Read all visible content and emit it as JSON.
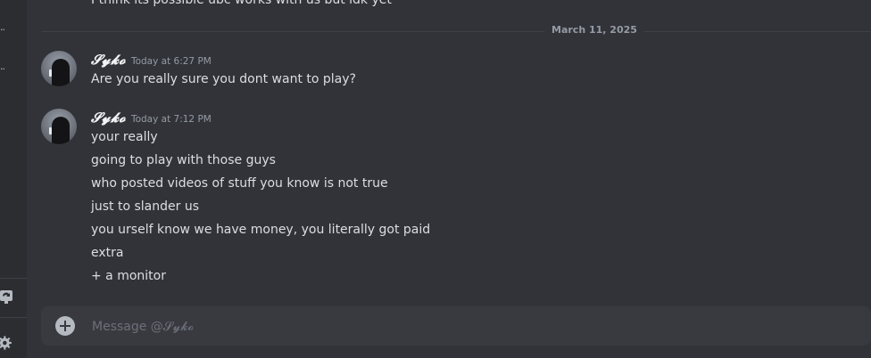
{
  "sidebar": {
    "dots_1": "..",
    "dots_2": "..",
    "icons": [
      "refresh-icon",
      "gear-icon"
    ]
  },
  "chat": {
    "previous_message_text": "I think its possible ubc works with us but idk yet",
    "date_divider": "March 11, 2025",
    "messages": [
      {
        "username": "𝓢𝔂𝓴𝓸",
        "timestamp": "Today at 6:27 PM",
        "lines": [
          "Are you really sure you dont want to play?"
        ]
      },
      {
        "username": "𝓢𝔂𝓴𝓸",
        "timestamp": "Today at 7:12 PM",
        "lines": [
          "your really",
          "going to play with those guys",
          "who posted videos of stuff you know is not true",
          "just to slander us",
          "you urself know we have money, you literally got paid",
          "extra",
          "+ a monitor"
        ]
      }
    ]
  },
  "composer": {
    "placeholder": "Message @𝓢𝔂𝓴𝓸",
    "value": ""
  },
  "colors": {
    "background": "#323339",
    "sidebar": "#2b2d31",
    "composer": "#383a40",
    "text": "#dbdee1",
    "muted": "#949ba4"
  }
}
